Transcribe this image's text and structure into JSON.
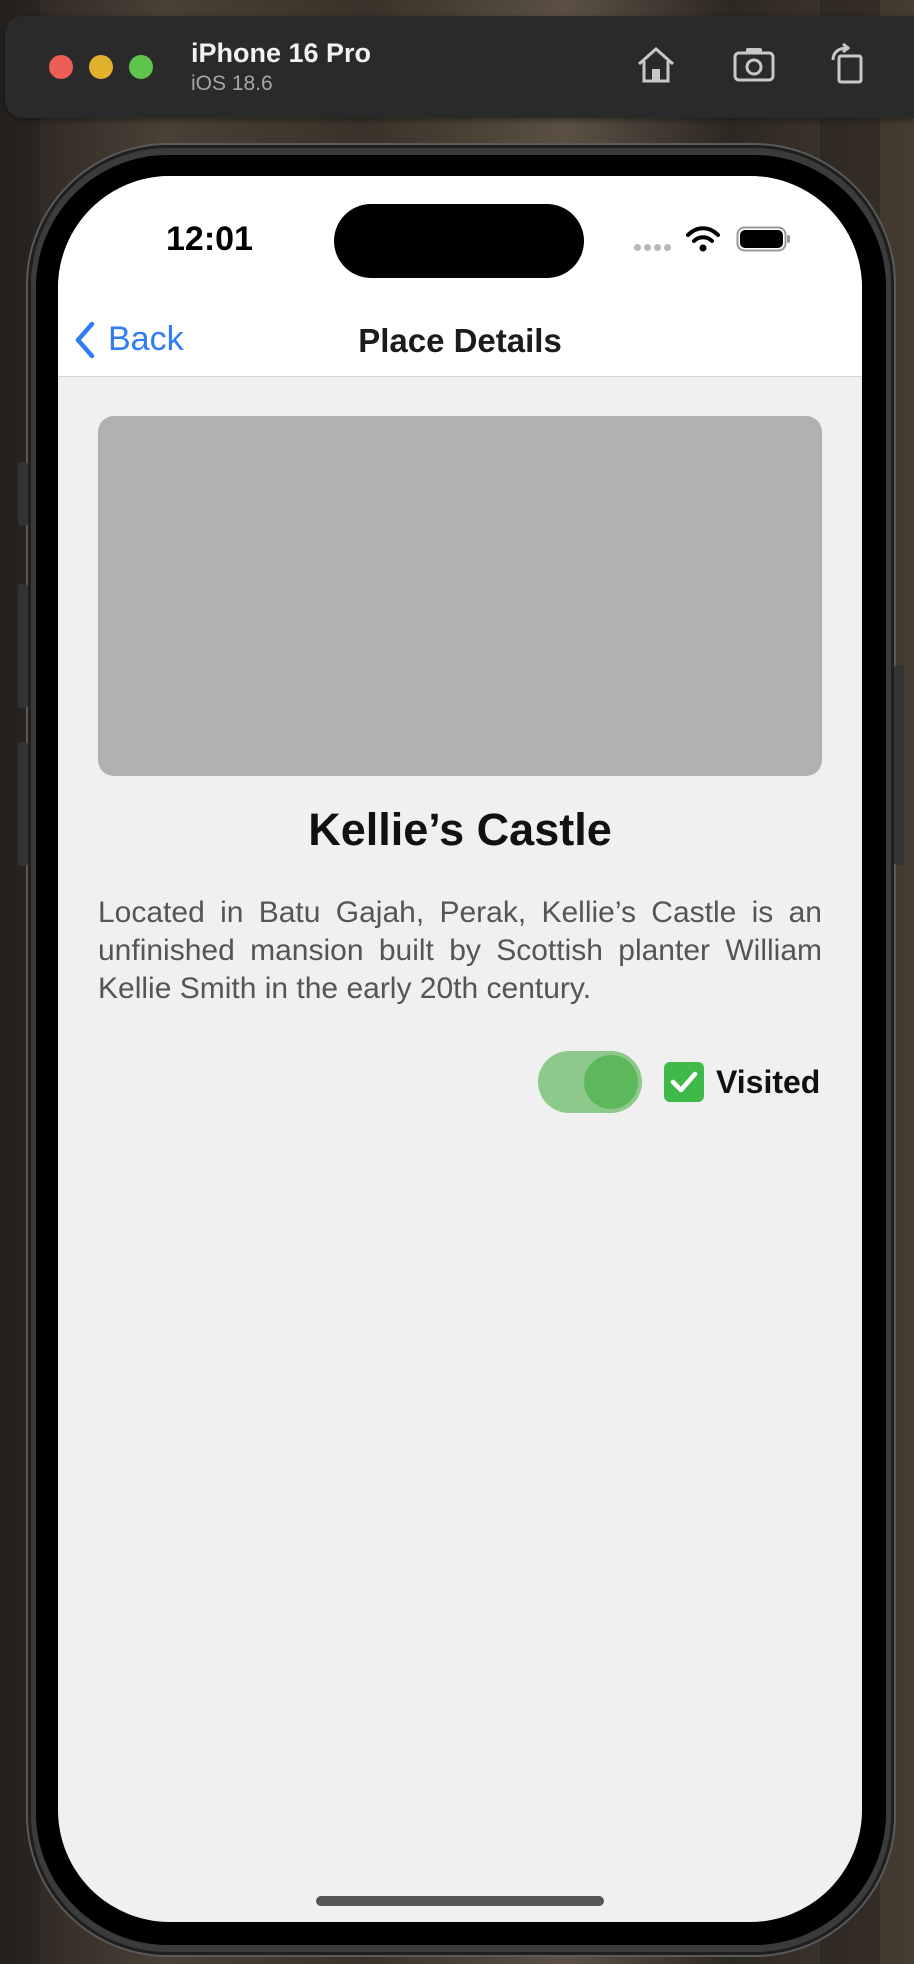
{
  "simulator": {
    "device_name": "iPhone 16 Pro",
    "os_version": "iOS 18.6",
    "icons": [
      "home-icon",
      "screenshot-icon",
      "rotate-icon"
    ]
  },
  "status_bar": {
    "time": "12:01"
  },
  "nav": {
    "back_label": "Back",
    "title": "Place Details"
  },
  "place": {
    "name": "Kellie’s Castle",
    "description": "Located in Batu Gajah, Perak, Kellie’s Castle is an unfinished mansion built by Scottish planter William Kellie Smith in the early 20th century."
  },
  "visited": {
    "label": "Visited",
    "toggle_on": true,
    "accent": "#8cc98a"
  },
  "colors": {
    "link_blue": "#2f7cf6",
    "check_green": "#3fb94a"
  }
}
